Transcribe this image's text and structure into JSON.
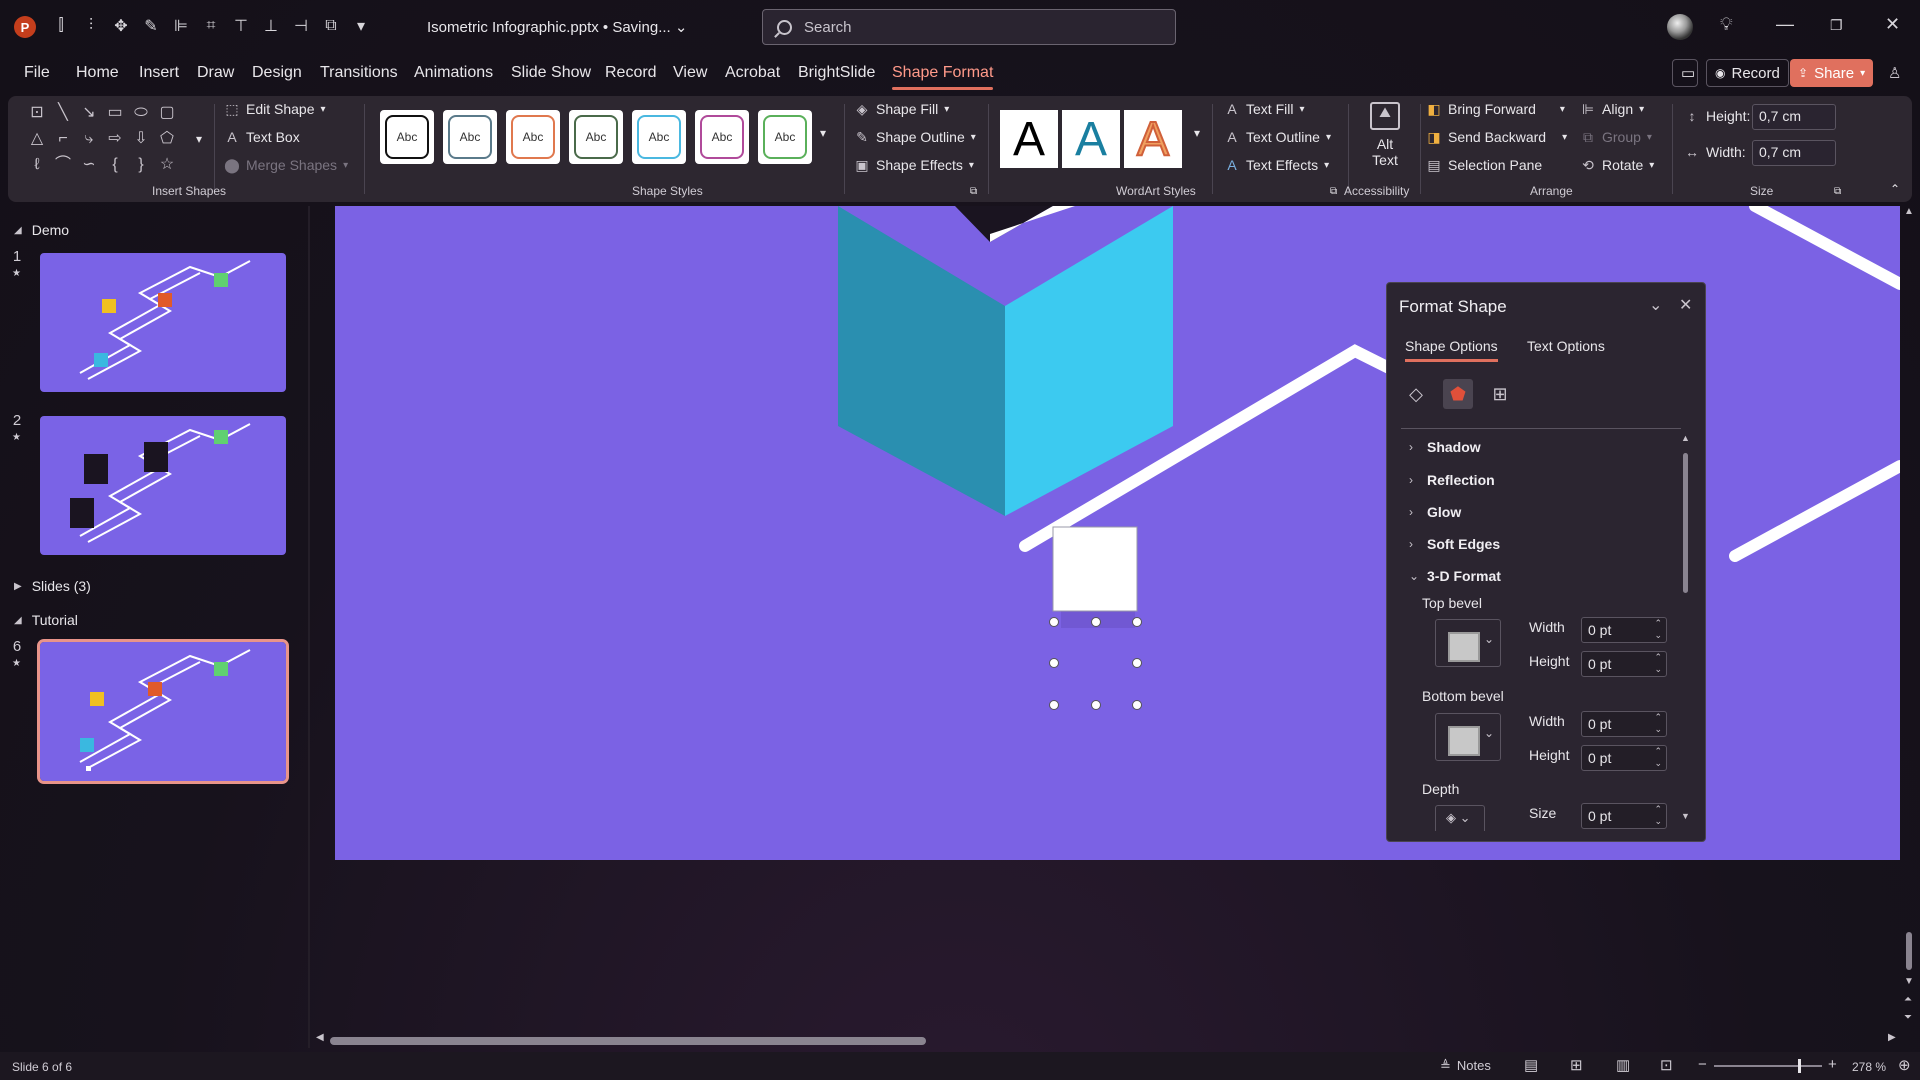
{
  "app": {
    "logo": "P",
    "document_title": "Isometric Infographic.pptx • Saving... ⌄"
  },
  "search": {
    "placeholder": "Search"
  },
  "menu_tabs": [
    "File",
    "Home",
    "Insert",
    "Draw",
    "Design",
    "Transitions",
    "Animations",
    "Slide Show",
    "Record",
    "View",
    "Acrobat",
    "BrightSlide",
    "Shape Format"
  ],
  "active_tab": "Shape Format",
  "title_actions": {
    "record": "Record",
    "share": "Share"
  },
  "ribbon": {
    "insert_shapes": {
      "edit_shape": "Edit Shape",
      "text_box": "Text Box",
      "merge_shapes": "Merge Shapes",
      "label": "Insert Shapes"
    },
    "shape_styles": {
      "preset_label": "Abc",
      "shape_fill": "Shape Fill",
      "shape_outline": "Shape Outline",
      "shape_effects": "Shape Effects",
      "label": "Shape Styles",
      "preset_colors": [
        "#111111",
        "#5a7a8a",
        "#e0784e",
        "#4a6a4a",
        "#4ab8e0",
        "#b04a9a",
        "#5ab05a"
      ]
    },
    "wordart_styles": {
      "letter": "A",
      "text_fill": "Text Fill",
      "text_outline": "Text Outline",
      "text_effects": "Text Effects",
      "label": "WordArt Styles"
    },
    "accessibility": {
      "alt_text_line1": "Alt",
      "alt_text_line2": "Text",
      "label": "Accessibility"
    },
    "arrange": {
      "bring_forward": "Bring Forward",
      "send_backward": "Send Backward",
      "selection_pane": "Selection Pane",
      "align": "Align",
      "group": "Group",
      "rotate": "Rotate",
      "label": "Arrange"
    },
    "size": {
      "height_label": "Height:",
      "height_value": "0,7 cm",
      "width_label": "Width:",
      "width_value": "0,7 cm",
      "label": "Size"
    }
  },
  "slide_pane": {
    "sections": [
      {
        "name": "Demo",
        "expanded": true
      },
      {
        "name": "Slides (3)",
        "expanded": false
      },
      {
        "name": "Tutorial",
        "expanded": true
      }
    ],
    "slides": [
      {
        "number": "1",
        "star": "★"
      },
      {
        "number": "2",
        "star": "★"
      },
      {
        "number": "6",
        "star": "★"
      }
    ]
  },
  "format_pane": {
    "title": "Format Shape",
    "tabs": [
      "Shape Options",
      "Text Options"
    ],
    "sections": [
      "Shadow",
      "Reflection",
      "Glow",
      "Soft Edges",
      "3-D Format"
    ],
    "top_bevel": {
      "label": "Top bevel",
      "width_label": "Width",
      "width": "0 pt",
      "height_label": "Height",
      "height": "0 pt"
    },
    "bottom_bevel": {
      "label": "Bottom bevel",
      "width_label": "Width",
      "width": "0 pt",
      "height_label": "Height",
      "height": "0 pt"
    },
    "depth": {
      "label": "Depth",
      "size_label": "Size",
      "size": "0 pt"
    }
  },
  "status": {
    "slide_info": "Slide 6 of 6",
    "notes": "Notes",
    "zoom": "278 %"
  },
  "colors": {
    "slide_bg": "#7b62e4",
    "accent": "#e0705e",
    "cube_top": "#4ad0f5",
    "cube_left": "#2a8fb0",
    "cube_right": "#3ab8e0"
  }
}
